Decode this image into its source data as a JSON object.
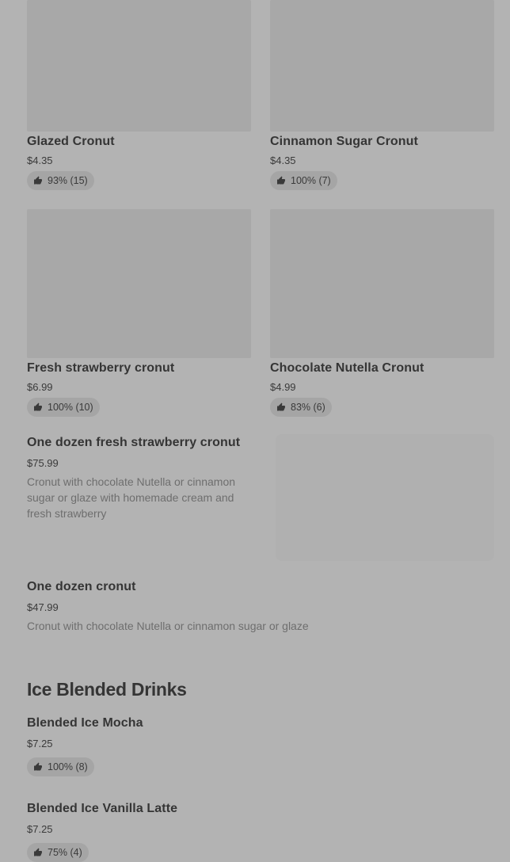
{
  "items_grid": [
    {
      "name": "Glazed Cronut",
      "price": "$4.35",
      "rating": "93% (15)"
    },
    {
      "name": "Cinnamon Sugar Cronut",
      "price": "$4.35",
      "rating": "100% (7)"
    },
    {
      "name": "Fresh strawberry cronut",
      "price": "$6.99",
      "rating": "100% (10)"
    },
    {
      "name": "Chocolate Nutella Cronut",
      "price": "$4.99",
      "rating": "83% (6)"
    }
  ],
  "dozen_strawberry": {
    "name": "One dozen fresh strawberry cronut",
    "price": "$75.99",
    "description": "Cronut with chocolate Nutella or cinnamon sugar or glaze with homemade cream and fresh strawberry"
  },
  "dozen": {
    "name": "One dozen cronut",
    "price": "$47.99",
    "description": "Cronut with chocolate Nutella or cinnamon sugar or glaze"
  },
  "section": {
    "title": "Ice Blended Drinks",
    "items": [
      {
        "name": "Blended Ice Mocha",
        "price": "$7.25",
        "rating": "100% (8)"
      },
      {
        "name": "Blended Ice Vanilla Latte",
        "price": "$7.25",
        "rating": "75% (4)"
      }
    ]
  },
  "icons": {
    "rating": "thumbs-up-icon"
  }
}
